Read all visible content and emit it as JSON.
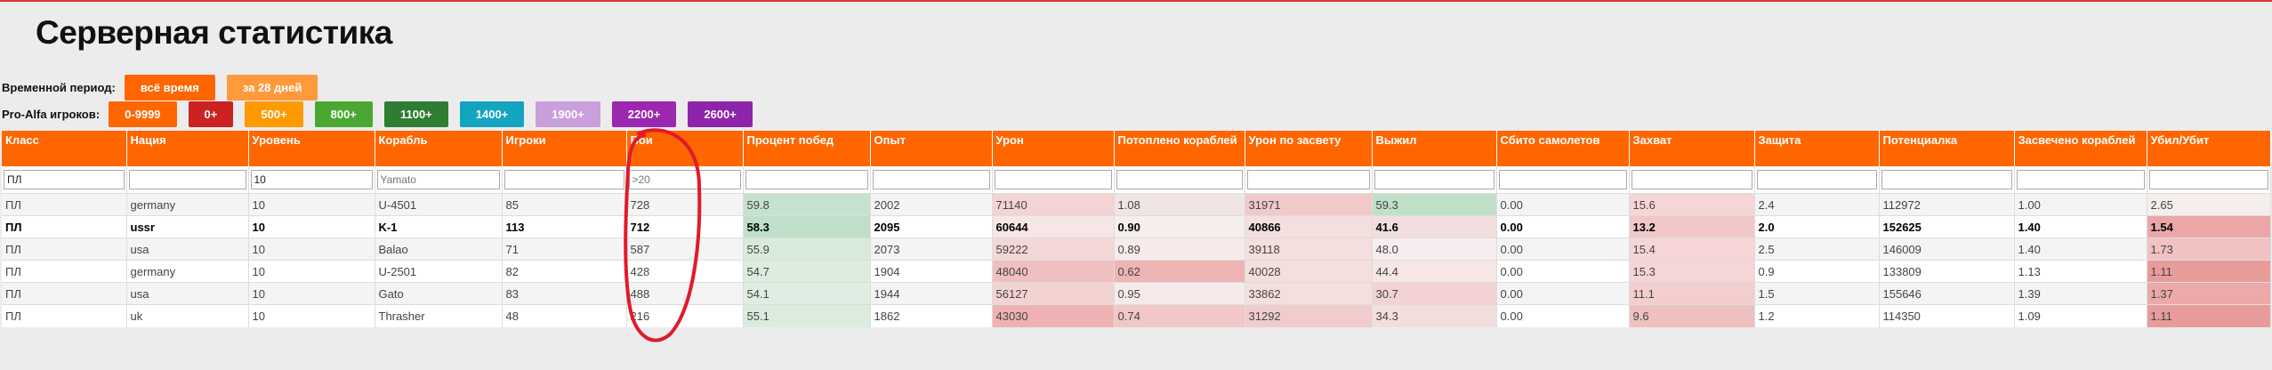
{
  "page_title": "Серверная статистика",
  "period": {
    "label": "Временной период:",
    "buttons": [
      {
        "label": "всё время",
        "color": "#ff6600"
      },
      {
        "label": "за 28 дней",
        "color": "#ff9a3c"
      }
    ]
  },
  "pro": {
    "label": "Pro-Alfa игроков:",
    "buttons": [
      {
        "label": "0-9999",
        "color": "#ff6600"
      },
      {
        "label": "0+",
        "color": "#cc2222"
      },
      {
        "label": "500+",
        "color": "#ff9900"
      },
      {
        "label": "800+",
        "color": "#4aa832"
      },
      {
        "label": "1100+",
        "color": "#2e7d32"
      },
      {
        "label": "1400+",
        "color": "#13a4c0"
      },
      {
        "label": "1900+",
        "color": "#c9a0dc"
      },
      {
        "label": "2200+",
        "color": "#9c27b0"
      },
      {
        "label": "2600+",
        "color": "#8e24aa"
      }
    ]
  },
  "table": {
    "headers": [
      "Класс",
      "Нация",
      "Уровень",
      "Корабль",
      "Игроки",
      "Бои",
      "Процент побед",
      "Опыт",
      "Урон",
      "Потоплено кораблей",
      "Урон по засвету",
      "Выжил",
      "Сбито самолетов",
      "Захват",
      "Защита",
      "Потенциалка",
      "Засвечено кораблей",
      "Убил/Убит"
    ],
    "filters": [
      "ПЛ",
      "",
      "10",
      "",
      "",
      "",
      "",
      "",
      "",
      "",
      "",
      "",
      "",
      "",
      "",
      "",
      "",
      ""
    ],
    "placeholders": [
      "",
      "",
      "",
      "Yamato",
      "",
      ">20",
      "",
      "",
      "",
      "",
      "",
      "",
      "",
      "",
      "",
      "",
      "",
      ""
    ],
    "rows": [
      {
        "bold": false,
        "cells": [
          "ПЛ",
          "germany",
          "10",
          "U-4501",
          "85",
          "728",
          "59.8",
          "2002",
          "71140",
          "1.08",
          "31971",
          "59.3",
          "0.00",
          "15.6",
          "2.4",
          "112972",
          "1.00",
          "2.65"
        ]
      },
      {
        "bold": true,
        "cells": [
          "ПЛ",
          "ussr",
          "10",
          "K-1",
          "113",
          "712",
          "58.3",
          "2095",
          "60644",
          "0.90",
          "40866",
          "41.6",
          "0.00",
          "13.2",
          "2.0",
          "152625",
          "1.40",
          "1.54"
        ]
      },
      {
        "bold": false,
        "cells": [
          "ПЛ",
          "usa",
          "10",
          "Balao",
          "71",
          "587",
          "55.9",
          "2073",
          "59222",
          "0.89",
          "39118",
          "48.0",
          "0.00",
          "15.4",
          "2.5",
          "146009",
          "1.40",
          "1.73"
        ]
      },
      {
        "bold": false,
        "cells": [
          "ПЛ",
          "germany",
          "10",
          "U-2501",
          "82",
          "428",
          "54.7",
          "1904",
          "48040",
          "0.62",
          "40028",
          "44.4",
          "0.00",
          "15.3",
          "0.9",
          "133809",
          "1.13",
          "1.11"
        ]
      },
      {
        "bold": false,
        "cells": [
          "ПЛ",
          "usa",
          "10",
          "Gato",
          "83",
          "488",
          "54.1",
          "1944",
          "56127",
          "0.95",
          "33862",
          "30.7",
          "0.00",
          "11.1",
          "1.5",
          "155646",
          "1.39",
          "1.37"
        ]
      },
      {
        "bold": false,
        "cells": [
          "ПЛ",
          "uk",
          "10",
          "Thrasher",
          "48",
          "216",
          "55.1",
          "1862",
          "43030",
          "0.74",
          "31292",
          "34.3",
          "0.00",
          "9.6",
          "1.2",
          "114350",
          "1.09",
          "1.11"
        ]
      }
    ],
    "cell_colors": [
      {
        "6": "#c6e2cf",
        "8": "#f3d3d3",
        "9": "#f1e4e4",
        "10": "#f0c9c9",
        "11": "#c0e0c8",
        "13": "#f5d5d5",
        "17": "#f6eded"
      },
      {
        "6": "#c0dfc9",
        "8": "#f6e6e6",
        "9": "#f6eded",
        "10": "#f4dede",
        "11": "#f2dede",
        "13": "#f1c8c8",
        "17": "#eba7a7"
      },
      {
        "6": "#d7eadc",
        "8": "#f3d6d6",
        "9": "#f6eaea",
        "10": "#f4dede",
        "11": "#f6eeee",
        "13": "#f5d5d5",
        "17": "#f0c2c2"
      },
      {
        "6": "#dcecdf",
        "8": "#f0c0c0",
        "9": "#efb4b4",
        "10": "#f4dede",
        "11": "#f6e6e6",
        "13": "#f5d5d5",
        "17": "#e89b9b"
      },
      {
        "6": "#dfeee2",
        "8": "#f3d2d2",
        "9": "#f6eaea",
        "10": "#f4dede",
        "11": "#f2d2d2",
        "13": "#f2cece",
        "17": "#eca9a9"
      },
      {
        "6": "#dbecdf",
        "8": "#efb2b2",
        "9": "#f1c7c7",
        "10": "#f1cccc",
        "11": "#f4dddd",
        "13": "#eec0c0",
        "17": "#e89b9b"
      }
    ]
  },
  "annotation": {
    "color": "#e11a2a"
  }
}
